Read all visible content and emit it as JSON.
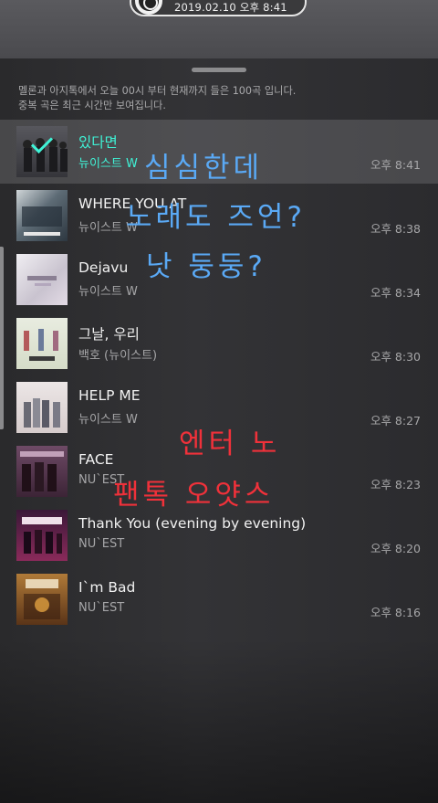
{
  "status": {
    "datetime": "2019.02.10 오후 8:41"
  },
  "notice": {
    "line1": "멜론과 아지톡에서 오늘 00시 부터 현재까지 들은 100곡 입니다.",
    "line2": "중복 곡은 최근 시간만 보여집니다."
  },
  "songs": [
    {
      "title": "있다면",
      "artist": "뉴이스트 W",
      "time": "오후 8:41",
      "playing": true,
      "art": "#4a4a50"
    },
    {
      "title": "WHERE YOU AT",
      "artist": "뉴이스트 W",
      "time": "오후 8:38",
      "art": "#3c4650"
    },
    {
      "title": "Dejavu",
      "artist": "뉴이스트 W",
      "time": "오후 8:34",
      "art": "#d8d4dc"
    },
    {
      "title": "그날, 우리",
      "artist": "백호 (뉴이스트)",
      "time": "오후 8:30",
      "art": "#d9d9cc"
    },
    {
      "title": "HELP ME",
      "artist": "뉴이스트 W",
      "time": "오후 8:27",
      "art": "#e2dada"
    },
    {
      "title": "FACE",
      "artist": "NU`EST",
      "time": "오후 8:23",
      "art": "#5a3a52"
    },
    {
      "title": "Thank You (evening by evening)",
      "artist": "NU`EST",
      "time": "오후 8:20",
      "art": "#6a2a4a"
    },
    {
      "title": "I`m Bad",
      "artist": "NU`EST",
      "time": "오후 8:16",
      "art": "#8a5a2a"
    }
  ],
  "handwriting": {
    "blue1": "심심한데",
    "blue2": "노래도 즈언?",
    "blue3": "낫 둥둥?",
    "red1": "엔터 노",
    "red2": "팬톡 오얏스"
  }
}
